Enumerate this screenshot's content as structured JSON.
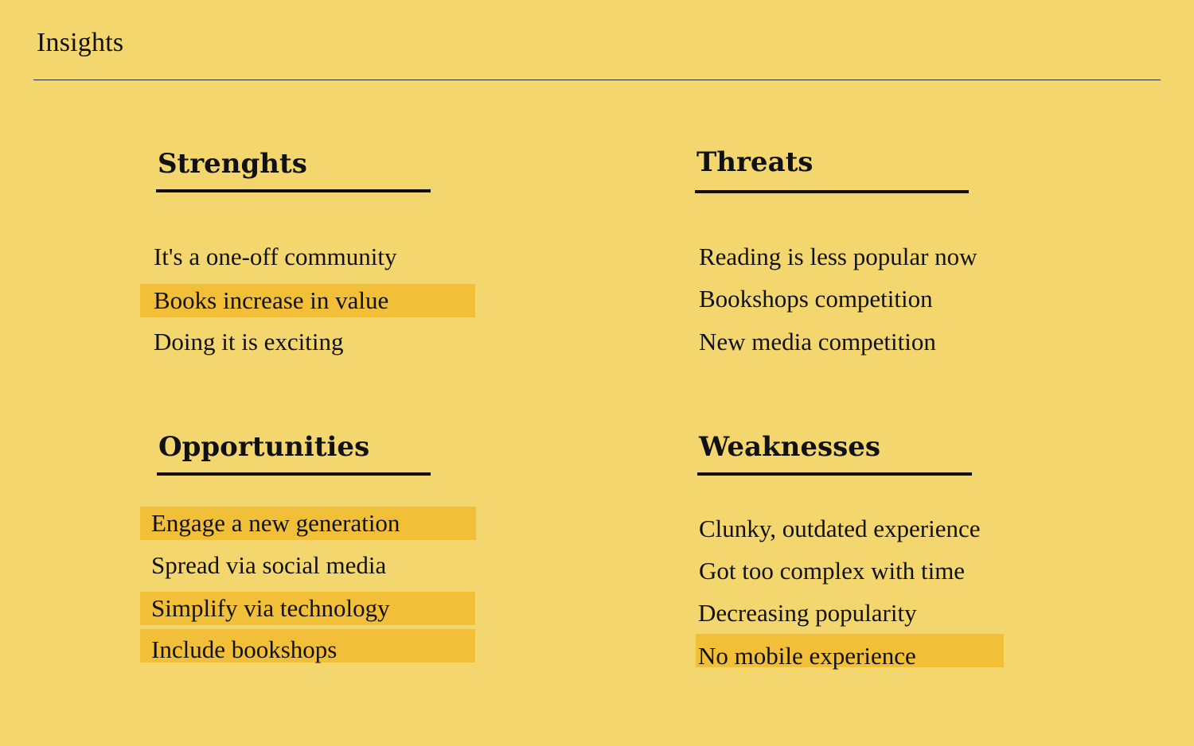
{
  "header": {
    "title": "Insights"
  },
  "colors": {
    "background": "#F3D76E",
    "highlight": "#F1BF38",
    "text": "#111111"
  },
  "sections": {
    "strengths": {
      "heading": "Strenghts",
      "items": [
        {
          "text": "It's a one-off community",
          "highlighted": false
        },
        {
          "text": "Books increase in value",
          "highlighted": true
        },
        {
          "text": "Doing it is exciting",
          "highlighted": false
        }
      ]
    },
    "threats": {
      "heading": "Threats",
      "items": [
        {
          "text": "Reading is less popular now",
          "highlighted": false
        },
        {
          "text": "Bookshops competition",
          "highlighted": false
        },
        {
          "text": "New media competition",
          "highlighted": false
        }
      ]
    },
    "opportunities": {
      "heading": "Opportunities",
      "items": [
        {
          "text": "Engage a new generation",
          "highlighted": true
        },
        {
          "text": "Spread via social media",
          "highlighted": false
        },
        {
          "text": "Simplify via technology",
          "highlighted": true
        },
        {
          "text": "Include bookshops",
          "highlighted": true
        }
      ]
    },
    "weaknesses": {
      "heading": "Weaknesses",
      "items": [
        {
          "text": "Clunky, outdated experience",
          "highlighted": false
        },
        {
          "text": "Got too complex with time",
          "highlighted": false
        },
        {
          "text": "Decreasing popularity",
          "highlighted": false
        },
        {
          "text": "No mobile experience",
          "highlighted": true
        }
      ]
    }
  }
}
